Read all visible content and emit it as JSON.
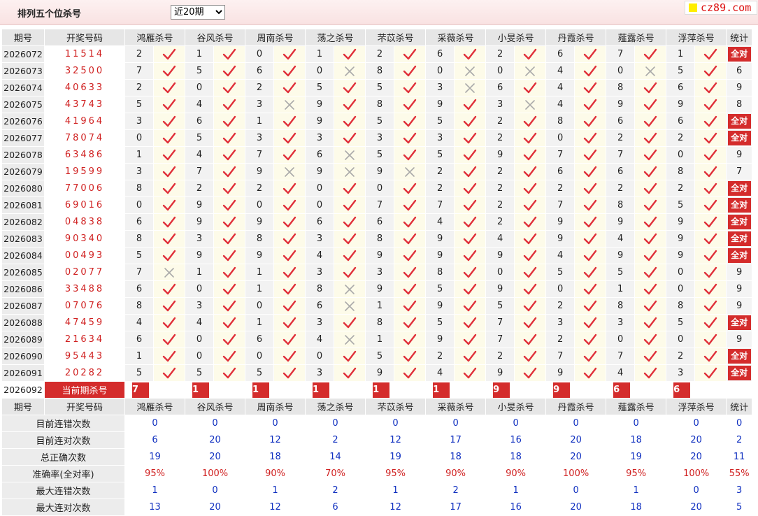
{
  "header": {
    "title": "排列五个位杀号",
    "period_select": "近20期",
    "logo_text": "cz89.com"
  },
  "columns": {
    "issue": "期号",
    "draw": "开奖号码",
    "experts": [
      "鸿雁杀号",
      "谷风杀号",
      "周南杀号",
      "荡之杀号",
      "芣苡杀号",
      "采薇杀号",
      "小旻杀号",
      "丹霞杀号",
      "薤露杀号",
      "浮萍杀号"
    ],
    "stat": "统计"
  },
  "rows": [
    {
      "issue": "2026072",
      "draw": "11514",
      "v": [
        2,
        1,
        0,
        1,
        2,
        6,
        2,
        6,
        7,
        1
      ],
      "ok": [
        1,
        1,
        1,
        1,
        1,
        1,
        1,
        1,
        1,
        1
      ],
      "stat": "全对"
    },
    {
      "issue": "2026073",
      "draw": "32500",
      "v": [
        7,
        5,
        6,
        0,
        8,
        0,
        0,
        4,
        0,
        5
      ],
      "ok": [
        1,
        1,
        1,
        0,
        1,
        0,
        0,
        1,
        0,
        1
      ],
      "stat": "6"
    },
    {
      "issue": "2026074",
      "draw": "40633",
      "v": [
        2,
        0,
        2,
        5,
        5,
        3,
        6,
        4,
        8,
        6
      ],
      "ok": [
        1,
        1,
        1,
        1,
        1,
        0,
        1,
        1,
        1,
        1
      ],
      "stat": "9"
    },
    {
      "issue": "2026075",
      "draw": "43743",
      "v": [
        5,
        4,
        3,
        9,
        8,
        9,
        3,
        4,
        9,
        9
      ],
      "ok": [
        1,
        1,
        0,
        1,
        1,
        1,
        0,
        1,
        1,
        1
      ],
      "stat": "8"
    },
    {
      "issue": "2026076",
      "draw": "41964",
      "v": [
        3,
        6,
        1,
        9,
        5,
        5,
        2,
        8,
        6,
        6
      ],
      "ok": [
        1,
        1,
        1,
        1,
        1,
        1,
        1,
        1,
        1,
        1
      ],
      "stat": "全对"
    },
    {
      "issue": "2026077",
      "draw": "78074",
      "v": [
        0,
        5,
        3,
        3,
        3,
        3,
        2,
        0,
        2,
        2
      ],
      "ok": [
        1,
        1,
        1,
        1,
        1,
        1,
        1,
        1,
        1,
        1
      ],
      "stat": "全对"
    },
    {
      "issue": "2026078",
      "draw": "63486",
      "v": [
        1,
        4,
        7,
        6,
        5,
        5,
        9,
        7,
        7,
        0
      ],
      "ok": [
        1,
        1,
        1,
        0,
        1,
        1,
        1,
        1,
        1,
        1
      ],
      "stat": "9"
    },
    {
      "issue": "2026079",
      "draw": "19599",
      "v": [
        3,
        7,
        9,
        9,
        9,
        2,
        2,
        6,
        6,
        8
      ],
      "ok": [
        1,
        1,
        0,
        0,
        0,
        1,
        1,
        1,
        1,
        1
      ],
      "stat": "7"
    },
    {
      "issue": "2026080",
      "draw": "77006",
      "v": [
        8,
        2,
        2,
        0,
        0,
        2,
        2,
        2,
        2,
        2
      ],
      "ok": [
        1,
        1,
        1,
        1,
        1,
        1,
        1,
        1,
        1,
        1
      ],
      "stat": "全对"
    },
    {
      "issue": "2026081",
      "draw": "69016",
      "v": [
        0,
        9,
        0,
        0,
        7,
        7,
        2,
        7,
        8,
        5
      ],
      "ok": [
        1,
        1,
        1,
        1,
        1,
        1,
        1,
        1,
        1,
        1
      ],
      "stat": "全对"
    },
    {
      "issue": "2026082",
      "draw": "04838",
      "v": [
        6,
        9,
        9,
        6,
        6,
        4,
        2,
        9,
        9,
        9
      ],
      "ok": [
        1,
        1,
        1,
        1,
        1,
        1,
        1,
        1,
        1,
        1
      ],
      "stat": "全对"
    },
    {
      "issue": "2026083",
      "draw": "90340",
      "v": [
        8,
        3,
        8,
        3,
        8,
        9,
        4,
        9,
        4,
        9
      ],
      "ok": [
        1,
        1,
        1,
        1,
        1,
        1,
        1,
        1,
        1,
        1
      ],
      "stat": "全对"
    },
    {
      "issue": "2026084",
      "draw": "00493",
      "v": [
        5,
        9,
        9,
        4,
        9,
        9,
        9,
        4,
        9,
        9
      ],
      "ok": [
        1,
        1,
        1,
        1,
        1,
        1,
        1,
        1,
        1,
        1
      ],
      "stat": "全对"
    },
    {
      "issue": "2026085",
      "draw": "02077",
      "v": [
        7,
        1,
        1,
        3,
        3,
        8,
        0,
        5,
        5,
        0
      ],
      "ok": [
        0,
        1,
        1,
        1,
        1,
        1,
        1,
        1,
        1,
        1
      ],
      "stat": "9"
    },
    {
      "issue": "2026086",
      "draw": "33488",
      "v": [
        6,
        0,
        1,
        8,
        9,
        5,
        9,
        0,
        1,
        0
      ],
      "ok": [
        1,
        1,
        1,
        0,
        1,
        1,
        1,
        1,
        1,
        1
      ],
      "stat": "9"
    },
    {
      "issue": "2026087",
      "draw": "07076",
      "v": [
        8,
        3,
        0,
        6,
        1,
        9,
        5,
        2,
        8,
        8
      ],
      "ok": [
        1,
        1,
        1,
        0,
        1,
        1,
        1,
        1,
        1,
        1
      ],
      "stat": "9"
    },
    {
      "issue": "2026088",
      "draw": "47459",
      "v": [
        4,
        4,
        1,
        3,
        8,
        5,
        7,
        3,
        3,
        5
      ],
      "ok": [
        1,
        1,
        1,
        1,
        1,
        1,
        1,
        1,
        1,
        1
      ],
      "stat": "全对"
    },
    {
      "issue": "2026089",
      "draw": "21634",
      "v": [
        6,
        0,
        6,
        4,
        1,
        9,
        7,
        2,
        0,
        0
      ],
      "ok": [
        1,
        1,
        1,
        0,
        1,
        1,
        1,
        1,
        1,
        1
      ],
      "stat": "9"
    },
    {
      "issue": "2026090",
      "draw": "95443",
      "v": [
        1,
        0,
        0,
        0,
        5,
        2,
        2,
        7,
        7,
        2
      ],
      "ok": [
        1,
        1,
        1,
        1,
        1,
        1,
        1,
        1,
        1,
        1
      ],
      "stat": "全对"
    },
    {
      "issue": "2026091",
      "draw": "20282",
      "v": [
        5,
        5,
        5,
        3,
        9,
        4,
        9,
        9,
        4,
        3
      ],
      "ok": [
        1,
        1,
        1,
        1,
        1,
        1,
        1,
        1,
        1,
        1
      ],
      "stat": "全对"
    }
  ],
  "current": {
    "issue": "2026092",
    "label": "当前期杀号",
    "kills": [
      "7",
      "1",
      "1",
      "1",
      "1",
      "1",
      "9",
      "9",
      "6",
      "6"
    ]
  },
  "summary": [
    {
      "label": "目前连错次数",
      "values": [
        "0",
        "0",
        "0",
        "0",
        "0",
        "0",
        "0",
        "0",
        "0",
        "0",
        "0"
      ]
    },
    {
      "label": "目前连对次数",
      "values": [
        "6",
        "20",
        "12",
        "2",
        "12",
        "17",
        "16",
        "20",
        "18",
        "20",
        "2"
      ]
    },
    {
      "label": "总正确次数",
      "values": [
        "19",
        "20",
        "18",
        "14",
        "19",
        "18",
        "18",
        "20",
        "19",
        "20",
        "11"
      ]
    },
    {
      "label": "准确率(全对率)",
      "values": [
        "95%",
        "100%",
        "90%",
        "70%",
        "95%",
        "90%",
        "90%",
        "100%",
        "95%",
        "100%",
        "55%"
      ],
      "red": true
    },
    {
      "label": "最大连错次数",
      "values": [
        "1",
        "0",
        "1",
        "2",
        "1",
        "2",
        "1",
        "0",
        "1",
        "0",
        "3"
      ]
    },
    {
      "label": "最大连对次数",
      "values": [
        "13",
        "20",
        "12",
        "6",
        "12",
        "17",
        "16",
        "20",
        "18",
        "20",
        "5"
      ]
    }
  ],
  "colors": {
    "accent": "#d42c2c",
    "check": "#e0303a",
    "cross": "#aaaaaa",
    "summary_blue": "#1030c0",
    "highlight": "#fdfbe9"
  }
}
